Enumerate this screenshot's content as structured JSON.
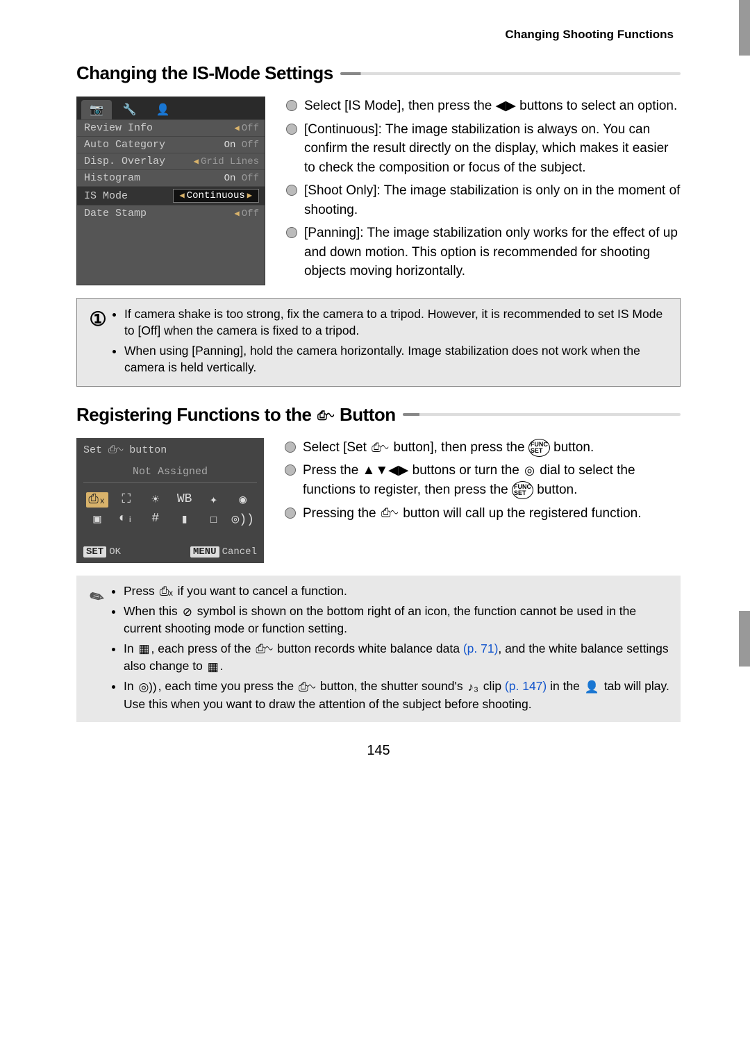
{
  "header": "Changing Shooting Functions",
  "page_number": "145",
  "section1": {
    "title": "Changing the IS-Mode Settings",
    "menu": {
      "tabs": [
        "📷",
        "🔧",
        "👤"
      ],
      "rows": [
        {
          "label": "Review Info",
          "value": "Off"
        },
        {
          "label": "Auto Category",
          "value_on": "On",
          "value_off": "Off"
        },
        {
          "label": "Disp. Overlay",
          "value": "Grid Lines"
        },
        {
          "label": "Histogram",
          "value_on": "On",
          "value_off": "Off"
        },
        {
          "label": "IS Mode",
          "value": "Continuous",
          "highlight": true
        },
        {
          "label": "Date Stamp",
          "value": "Off"
        }
      ]
    },
    "bullets": [
      "Select [IS Mode], then press the ◀▶ buttons to select an option.",
      "[Continuous]: The image stabilization is always on. You can confirm the result directly on the display, which makes it easier to check the composition or focus of the subject.",
      "[Shoot Only]: The image stabilization is only on in the moment of shooting.",
      "[Panning]: The image stabilization only works for the effect of up and down motion. This option is recommended for shooting objects moving horizontally."
    ],
    "note": [
      "If camera shake is too strong, fix the camera to a tripod. However, it is recommended to set IS Mode to [Off] when the camera is fixed to a tripod.",
      "When using [Panning], hold the camera horizontally. Image stabilization does not work when the camera is held vertically."
    ]
  },
  "section2": {
    "title_pre": "Registering Functions to the ",
    "title_post": " Button",
    "screen": {
      "title": "Set ⎙∿ button",
      "subtitle": "Not Assigned",
      "ok_label": "OK",
      "cancel_label": "Cancel",
      "set_btn": "SET",
      "menu_btn": "MENU"
    },
    "bullets": [
      {
        "pre": "Select [Set ",
        "icon": "print-s",
        "mid": " button], then press the ",
        "icon2": "func",
        "post": " button."
      },
      {
        "pre": "Press the ▲▼◀▶ buttons or turn the ",
        "icon": "dial",
        "mid": " dial to select the functions to register, then press the ",
        "icon2": "func",
        "post": " button."
      },
      {
        "pre": "Pressing the ",
        "icon": "print-s",
        "mid": " button will call up the registered function.",
        "icon2": "",
        "post": ""
      }
    ],
    "note_items": {
      "li1_pre": "Press ",
      "li1_post": " if you want to cancel a function.",
      "li2_pre": "When this ",
      "li2_post": " symbol is shown on the bottom right of an icon, the function cannot be used in the current shooting mode or function setting.",
      "li3_pre": "In ",
      "li3_mid": ", each press of the ",
      "li3_mid2": " button records white balance data ",
      "li3_link": "(p. 71)",
      "li3_mid3": ", and the white balance settings also change to ",
      "li3_post": ".",
      "li4_pre": "In ",
      "li4_mid": ", each time you press the ",
      "li4_mid2": " button, the shutter sound's ",
      "li4_mid3": " clip ",
      "li4_link": "(p. 147)",
      "li4_mid4": " in the ",
      "li4_post": " tab will play. Use this when you want to draw the attention of the subject before shooting."
    }
  }
}
